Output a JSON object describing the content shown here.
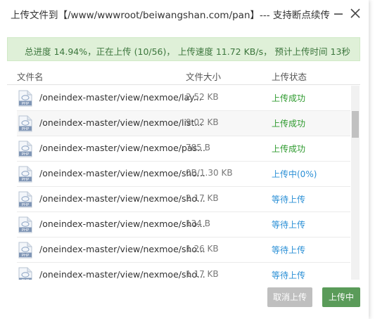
{
  "dialog": {
    "title": "上传文件到【/www/wwwroot/beiwangshan.com/pan】--- 支持断点续传",
    "minimize_icon": "minus-icon",
    "close_icon": "close-icon"
  },
  "progress": {
    "text": "总进度 14.94%，正在上传 (10/56)，  上传速度 11.72 KB/s，  预计上传时间 13秒",
    "percent": 14.94,
    "current": 10,
    "total": 56
  },
  "columns": {
    "name": "文件名",
    "size": "文件大小",
    "status": "上传状态"
  },
  "files": [
    {
      "name": "/oneindex-master/view/nexmoe/lay...",
      "size": "2.52 KB",
      "status": "上传成功",
      "state": "success"
    },
    {
      "name": "/oneindex-master/view/nexmoe/list...",
      "size": "9.02 KB",
      "status": "上传成功",
      "state": "success"
    },
    {
      "name": "/oneindex-master/view/nexmoe/pas...",
      "size": "785 B",
      "status": "上传成功",
      "state": "success"
    },
    {
      "name": "/oneindex-master/view/nexmoe/sho...",
      "size": "0B/1.30 KB",
      "status": "上传中(0%)",
      "state": "uploading"
    },
    {
      "name": "/oneindex-master/view/nexmoe/sho...",
      "size": "2.17 KB",
      "status": "等待上传",
      "state": "waiting"
    },
    {
      "name": "/oneindex-master/view/nexmoe/sho...",
      "size": "134 B",
      "status": "等待上传",
      "state": "waiting"
    },
    {
      "name": "/oneindex-master/view/nexmoe/sho...",
      "size": "1.26 KB",
      "status": "等待上传",
      "state": "waiting"
    },
    {
      "name": "/oneindex-master/view/nexmoe/sho...",
      "size": "1.17 KB",
      "status": "等待上传",
      "state": "waiting"
    }
  ],
  "file_icon": "php-file-icon",
  "file_icon_label": "PHP",
  "colors": {
    "success": "#2e9a2e",
    "uploading": "#2a8fd6",
    "waiting": "#2a8fd6"
  },
  "buttons": {
    "cancel": "取消上传",
    "uploading": "上传中"
  }
}
